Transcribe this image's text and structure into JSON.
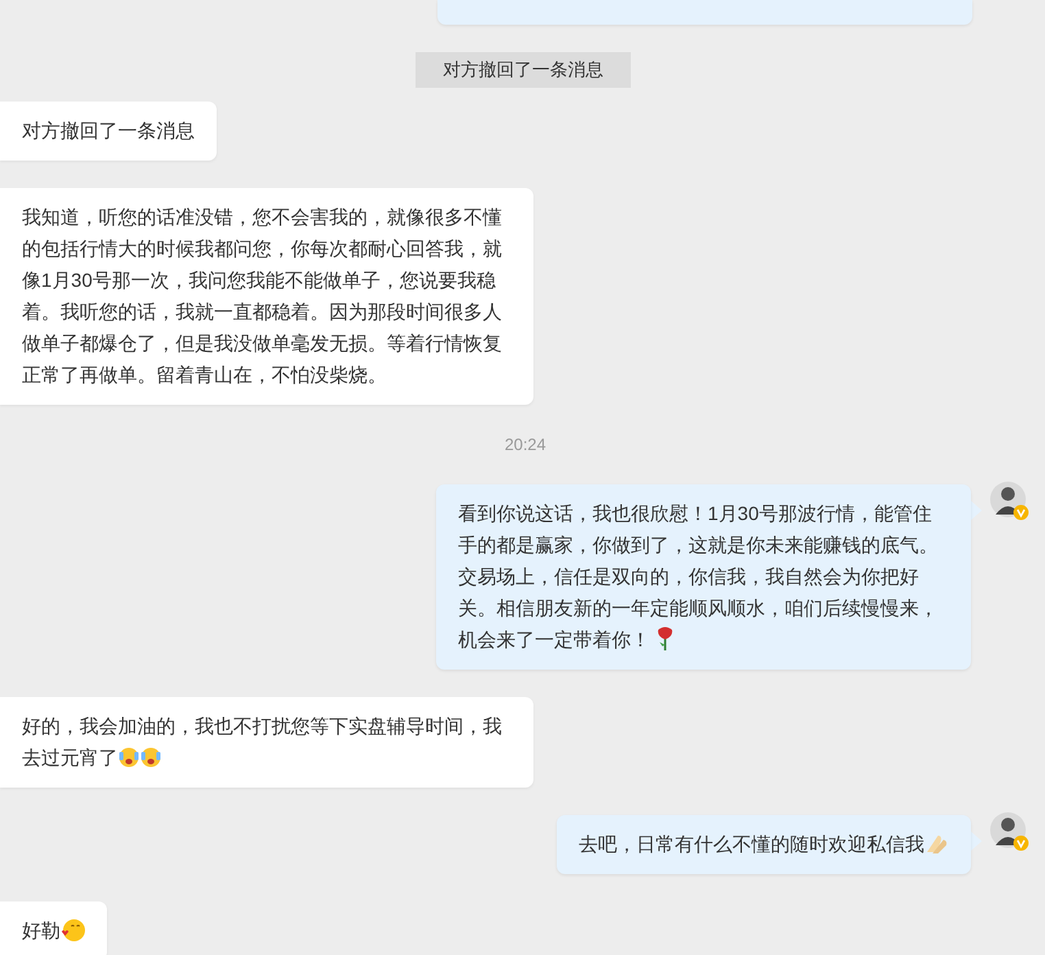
{
  "messages": [
    {
      "kind": "sent_cut"
    },
    {
      "kind": "notice",
      "text": "对方撤回了一条消息"
    },
    {
      "kind": "received",
      "text": "对方撤回了一条消息"
    },
    {
      "kind": "received",
      "text": "我知道，听您的话准没错，您不会害我的，就像很多不懂的包括行情大的时候我都问您，你每次都耐心回答我，就像1月30号那一次，我问您我能不能做单子，您说要我稳着。我听您的话，我就一直都稳着。因为那段时间很多人做单子都爆仓了，但是我没做单毫发无损。等着行情恢复正常了再做单。留着青山在，不怕没柴烧。"
    },
    {
      "kind": "time",
      "text": "20:24"
    },
    {
      "kind": "sent",
      "text": "看到你说这话，我也很欣慰！1月30号那波行情，能管住手的都是赢家，你做到了，这就是你未来能赚钱的底气。交易场上，信任是双向的，你信我，我自然会为你把好关。相信朋友新的一年定能顺风顺水，咱们后续慢慢来，机会来了一定带着你！",
      "icons": [
        {
          "kind": "rose"
        }
      ]
    },
    {
      "kind": "received",
      "text": "好的，我会加油的，我也不打扰您等下实盘辅导时间，我去过元宵了",
      "icons": [
        {
          "kind": "crying"
        },
        {
          "kind": "crying"
        }
      ]
    },
    {
      "kind": "sent",
      "text": "去吧，日常有什么不懂的随时欢迎私信我",
      "icons": [
        {
          "kind": "praying"
        }
      ]
    },
    {
      "kind": "received",
      "text": "好勒",
      "icons": [
        {
          "kind": "kiss"
        }
      ]
    }
  ]
}
